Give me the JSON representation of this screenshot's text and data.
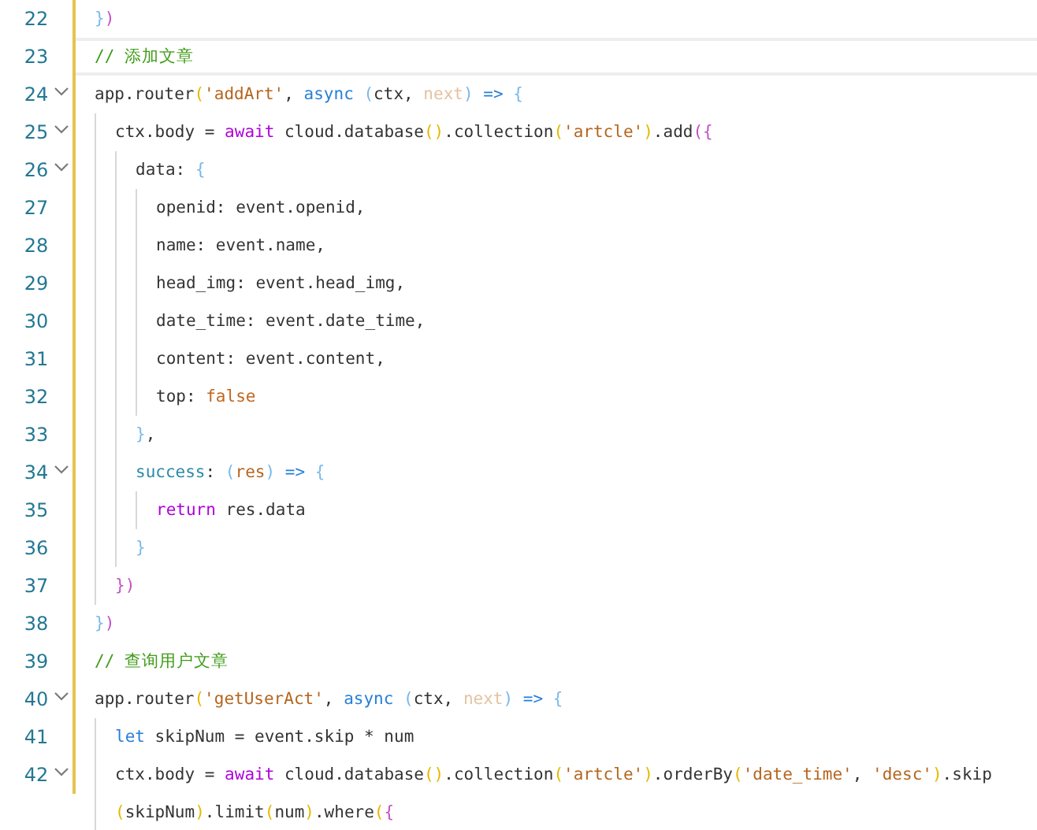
{
  "lines": [
    {
      "number": "22",
      "current": false,
      "foldable": false,
      "modified": true,
      "tokens": [
        {
          "text": "}",
          "kind": "b3"
        },
        {
          "text": ")",
          "kind": "b2"
        }
      ]
    },
    {
      "number": "23",
      "current": true,
      "foldable": false,
      "modified": true,
      "tokens": [
        {
          "text": "// 添加文章",
          "kind": "c"
        }
      ]
    },
    {
      "number": "24",
      "current": false,
      "foldable": true,
      "modified": true,
      "tokens": [
        {
          "text": "app.router",
          "kind": "t"
        },
        {
          "text": "(",
          "kind": "b1"
        },
        {
          "text": "'addArt'",
          "kind": "s"
        },
        {
          "text": ", ",
          "kind": "t"
        },
        {
          "text": "async",
          "kind": "st"
        },
        {
          "text": " (",
          "kind": "b3"
        },
        {
          "text": "ctx",
          "kind": "t"
        },
        {
          "text": ", ",
          "kind": "t"
        },
        {
          "text": "next",
          "kind": "u"
        },
        {
          "text": ")",
          "kind": "b3"
        },
        {
          "text": " =>",
          "kind": "st"
        },
        {
          "text": " {",
          "kind": "b3"
        }
      ],
      "children": [
        {
          "number": "25",
          "current": false,
          "foldable": true,
          "modified": true,
          "tokens": [
            {
              "text": "ctx.body = ",
              "kind": "t"
            },
            {
              "text": "await",
              "kind": "kw"
            },
            {
              "text": " cloud.database",
              "kind": "t"
            },
            {
              "text": "()",
              "kind": "b1"
            },
            {
              "text": ".collection",
              "kind": "t"
            },
            {
              "text": "(",
              "kind": "b1"
            },
            {
              "text": "'artcle'",
              "kind": "s"
            },
            {
              "text": ")",
              "kind": "b1"
            },
            {
              "text": ".add",
              "kind": "t"
            },
            {
              "text": "(",
              "kind": "b2"
            },
            {
              "text": "{",
              "kind": "b2"
            }
          ],
          "children": [
            {
              "number": "26",
              "current": false,
              "foldable": true,
              "modified": true,
              "tokens": [
                {
                  "text": "data: ",
                  "kind": "t"
                },
                {
                  "text": "{",
                  "kind": "b3"
                }
              ],
              "children": [
                {
                  "number": "27",
                  "current": false,
                  "foldable": false,
                  "modified": true,
                  "tokens": [
                    {
                      "text": "openid: event.openid,",
                      "kind": "t"
                    }
                  ]
                },
                {
                  "number": "28",
                  "current": false,
                  "foldable": false,
                  "modified": true,
                  "tokens": [
                    {
                      "text": "name: event.name,",
                      "kind": "t"
                    }
                  ]
                },
                {
                  "number": "29",
                  "current": false,
                  "foldable": false,
                  "modified": true,
                  "tokens": [
                    {
                      "text": "head_img: event.head_img,",
                      "kind": "t"
                    }
                  ]
                },
                {
                  "number": "30",
                  "current": false,
                  "foldable": false,
                  "modified": true,
                  "tokens": [
                    {
                      "text": "date_time: event.date_time,",
                      "kind": "t"
                    }
                  ]
                },
                {
                  "number": "31",
                  "current": false,
                  "foldable": false,
                  "modified": true,
                  "tokens": [
                    {
                      "text": "content: event.content,",
                      "kind": "t"
                    }
                  ]
                },
                {
                  "number": "32",
                  "current": false,
                  "foldable": false,
                  "modified": true,
                  "tokens": [
                    {
                      "text": "top: ",
                      "kind": "t"
                    },
                    {
                      "text": "false",
                      "kind": "l"
                    }
                  ]
                }
              ]
            },
            {
              "number": "33",
              "current": false,
              "foldable": false,
              "modified": true,
              "tokens": [
                {
                  "text": "}",
                  "kind": "b3"
                },
                {
                  "text": ",",
                  "kind": "t"
                }
              ]
            },
            {
              "number": "34",
              "current": false,
              "foldable": true,
              "modified": true,
              "tokens": [
                {
                  "text": "success",
                  "kind": "pr"
                },
                {
                  "text": ": ",
                  "kind": "t"
                },
                {
                  "text": "(",
                  "kind": "b3"
                },
                {
                  "text": "res",
                  "kind": "p"
                },
                {
                  "text": ")",
                  "kind": "b3"
                },
                {
                  "text": " =>",
                  "kind": "st"
                },
                {
                  "text": " {",
                  "kind": "b3"
                }
              ],
              "children": [
                {
                  "number": "35",
                  "current": false,
                  "foldable": false,
                  "modified": true,
                  "tokens": [
                    {
                      "text": "return",
                      "kind": "kw"
                    },
                    {
                      "text": " res.data",
                      "kind": "t"
                    }
                  ]
                }
              ]
            },
            {
              "number": "36",
              "current": false,
              "foldable": false,
              "modified": true,
              "tokens": [
                {
                  "text": "}",
                  "kind": "b3"
                }
              ]
            }
          ]
        },
        {
          "number": "37",
          "current": false,
          "foldable": false,
          "modified": true,
          "tokens": [
            {
              "text": "})",
              "kind": "b2"
            }
          ]
        }
      ]
    },
    {
      "number": "38",
      "current": false,
      "foldable": false,
      "modified": true,
      "tokens": [
        {
          "text": "}",
          "kind": "b3"
        },
        {
          "text": ")",
          "kind": "b2"
        }
      ]
    },
    {
      "number": "39",
      "current": false,
      "foldable": false,
      "modified": true,
      "tokens": [
        {
          "text": "// 查询用户文章",
          "kind": "c"
        }
      ]
    },
    {
      "number": "40",
      "current": false,
      "foldable": true,
      "modified": true,
      "tokens": [
        {
          "text": "app.router",
          "kind": "t"
        },
        {
          "text": "(",
          "kind": "b1"
        },
        {
          "text": "'getUserAct'",
          "kind": "s"
        },
        {
          "text": ", ",
          "kind": "t"
        },
        {
          "text": "async",
          "kind": "st"
        },
        {
          "text": " (",
          "kind": "b3"
        },
        {
          "text": "ctx",
          "kind": "t"
        },
        {
          "text": ", ",
          "kind": "t"
        },
        {
          "text": "next",
          "kind": "u"
        },
        {
          "text": ")",
          "kind": "b3"
        },
        {
          "text": " =>",
          "kind": "st"
        },
        {
          "text": " {",
          "kind": "b3"
        }
      ],
      "children": [
        {
          "number": "41",
          "current": false,
          "foldable": false,
          "modified": true,
          "tokens": [
            {
              "text": "let",
              "kind": "st"
            },
            {
              "text": " skipNum = event.skip * num",
              "kind": "t"
            }
          ]
        },
        {
          "number": "42",
          "current": false,
          "foldable": true,
          "modified": true,
          "tokens": [
            {
              "text": "ctx.body = ",
              "kind": "t"
            },
            {
              "text": "await",
              "kind": "kw"
            },
            {
              "text": " cloud.database",
              "kind": "t"
            },
            {
              "text": "()",
              "kind": "b1"
            },
            {
              "text": ".collection",
              "kind": "t"
            },
            {
              "text": "(",
              "kind": "b1"
            },
            {
              "text": "'artcle'",
              "kind": "s"
            },
            {
              "text": ")",
              "kind": "b1"
            },
            {
              "text": ".orderBy",
              "kind": "t"
            },
            {
              "text": "(",
              "kind": "b1"
            },
            {
              "text": "'date_time'",
              "kind": "s"
            },
            {
              "text": ", ",
              "kind": "t"
            },
            {
              "text": "'desc'",
              "kind": "s"
            },
            {
              "text": ")",
              "kind": "b1"
            },
            {
              "text": ".skip",
              "kind": "t"
            }
          ]
        },
        {
          "current": false,
          "foldable": false,
          "modified": false,
          "tokens": [
            {
              "text": "(",
              "kind": "b1"
            },
            {
              "text": "skipNum",
              "kind": "t"
            },
            {
              "text": ")",
              "kind": "b1"
            },
            {
              "text": ".limit",
              "kind": "t"
            },
            {
              "text": "(",
              "kind": "b1"
            },
            {
              "text": "num",
              "kind": "t"
            },
            {
              "text": ")",
              "kind": "b1"
            },
            {
              "text": ".where",
              "kind": "t"
            },
            {
              "text": "(",
              "kind": "b1"
            },
            {
              "text": "{",
              "kind": "b2"
            }
          ]
        }
      ]
    }
  ]
}
